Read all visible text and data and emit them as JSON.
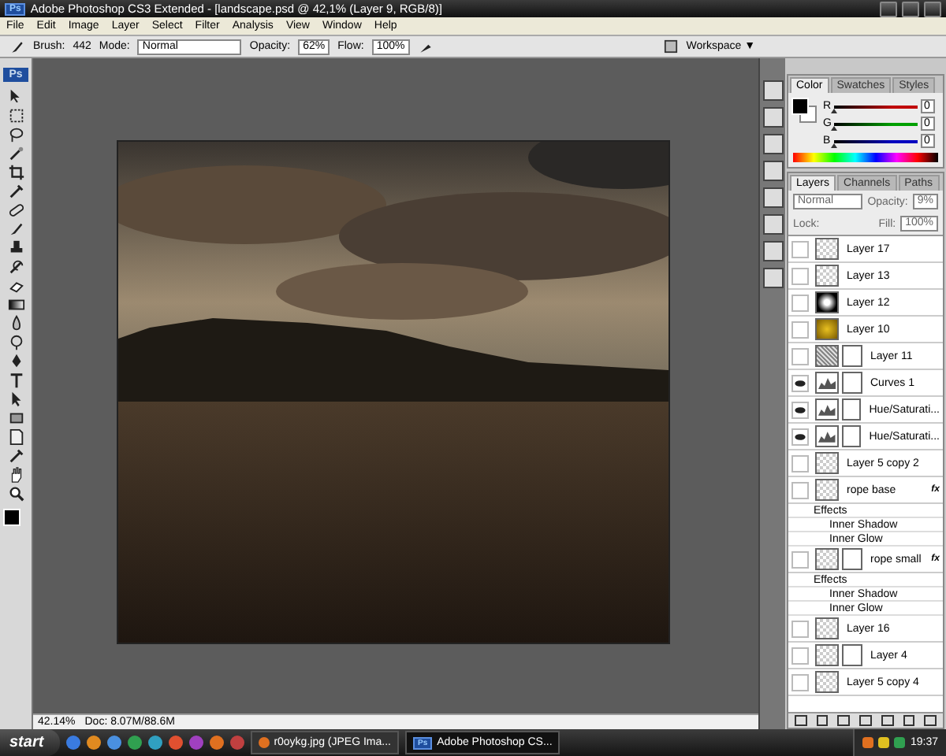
{
  "window": {
    "icon": "Ps",
    "title": "Adobe Photoshop CS3 Extended - [landscape.psd @ 42,1% (Layer 9, RGB/8)]"
  },
  "menu": [
    "File",
    "Edit",
    "Image",
    "Layer",
    "Select",
    "Filter",
    "Analysis",
    "View",
    "Window",
    "Help"
  ],
  "options_bar": {
    "brush_label": "Brush:",
    "brush_size": "442",
    "mode_label": "Mode:",
    "mode": "Normal",
    "opacity_label": "Opacity:",
    "opacity": "62%",
    "flow_label": "Flow:",
    "flow": "100%",
    "workspace": "Workspace ▼"
  },
  "toolbox": {
    "logo": "Ps"
  },
  "color_panel": {
    "tabs": [
      {
        "label": "Color",
        "selected": true
      },
      {
        "label": "Swatches",
        "selected": false
      },
      {
        "label": "Styles",
        "selected": false
      }
    ],
    "sliders": [
      {
        "label": "R",
        "level": 0,
        "value": "0",
        "color": "#c00000"
      },
      {
        "label": "G",
        "level": 0,
        "value": "0",
        "color": "#00a000"
      },
      {
        "label": "B",
        "level": 0,
        "value": "0",
        "color": "#0000c0"
      }
    ]
  },
  "layers_panel": {
    "tabs": [
      {
        "label": "Layers",
        "selected": true
      },
      {
        "label": "Channels",
        "selected": false
      },
      {
        "label": "Paths",
        "selected": false
      }
    ],
    "blend_mode": "Normal",
    "opacity_label": "Opacity:",
    "opacity": "9%",
    "lock_label": "Lock:",
    "fill_label": "Fill:",
    "fill": "100%",
    "items": [
      {
        "name": "Layer 17",
        "visible": false,
        "kind": "transparent",
        "mask": false,
        "fx": false
      },
      {
        "name": "Layer 13",
        "visible": false,
        "kind": "transparent",
        "mask": false,
        "fx": false
      },
      {
        "name": "Layer 12",
        "visible": false,
        "kind": "cloud",
        "mask": false,
        "fx": false
      },
      {
        "name": "Layer 10",
        "visible": false,
        "kind": "gold",
        "mask": false,
        "fx": false
      },
      {
        "name": "Layer 11",
        "visible": false,
        "kind": "texture",
        "mask": true,
        "fx": false
      },
      {
        "name": "Curves 1",
        "visible": true,
        "kind": "adjustment",
        "mask": true,
        "fx": false
      },
      {
        "name": "Hue/Saturati...",
        "visible": true,
        "kind": "adjustment",
        "mask": true,
        "fx": false
      },
      {
        "name": "Hue/Saturati...",
        "visible": true,
        "kind": "adjustment",
        "mask": true,
        "fx": false
      },
      {
        "name": "Layer 5 copy 2",
        "visible": false,
        "kind": "transparent",
        "mask": false,
        "fx": false
      },
      {
        "name": "rope base",
        "visible": false,
        "kind": "transparent",
        "mask": false,
        "fx": "fx",
        "effects_label": "Effects",
        "effects": [
          "Inner Shadow",
          "Inner Glow"
        ]
      },
      {
        "name": "rope small",
        "visible": false,
        "kind": "transparent",
        "mask": true,
        "fx": "fx",
        "effects_label": "Effects",
        "effects": [
          "Inner Shadow",
          "Inner Glow"
        ]
      },
      {
        "name": "Layer 16",
        "visible": false,
        "kind": "transparent",
        "mask": false,
        "fx": false
      },
      {
        "name": "Layer 4",
        "visible": false,
        "kind": "transparent",
        "mask": true,
        "fx": false
      },
      {
        "name": "Layer 5 copy 4",
        "visible": false,
        "kind": "transparent",
        "mask": false,
        "fx": false
      }
    ]
  },
  "status_bar": {
    "zoom": "42.14%",
    "doc": "Doc: 8.07M/88.6M"
  },
  "taskbar": {
    "start": "start",
    "tasks": [
      {
        "label": "r0oykg.jpg (JPEG Ima...",
        "selected": false,
        "kind": "browser"
      },
      {
        "label": "Adobe Photoshop CS...",
        "selected": true,
        "kind": "photoshop",
        "icon": "Ps"
      }
    ],
    "clock": "19:37"
  }
}
